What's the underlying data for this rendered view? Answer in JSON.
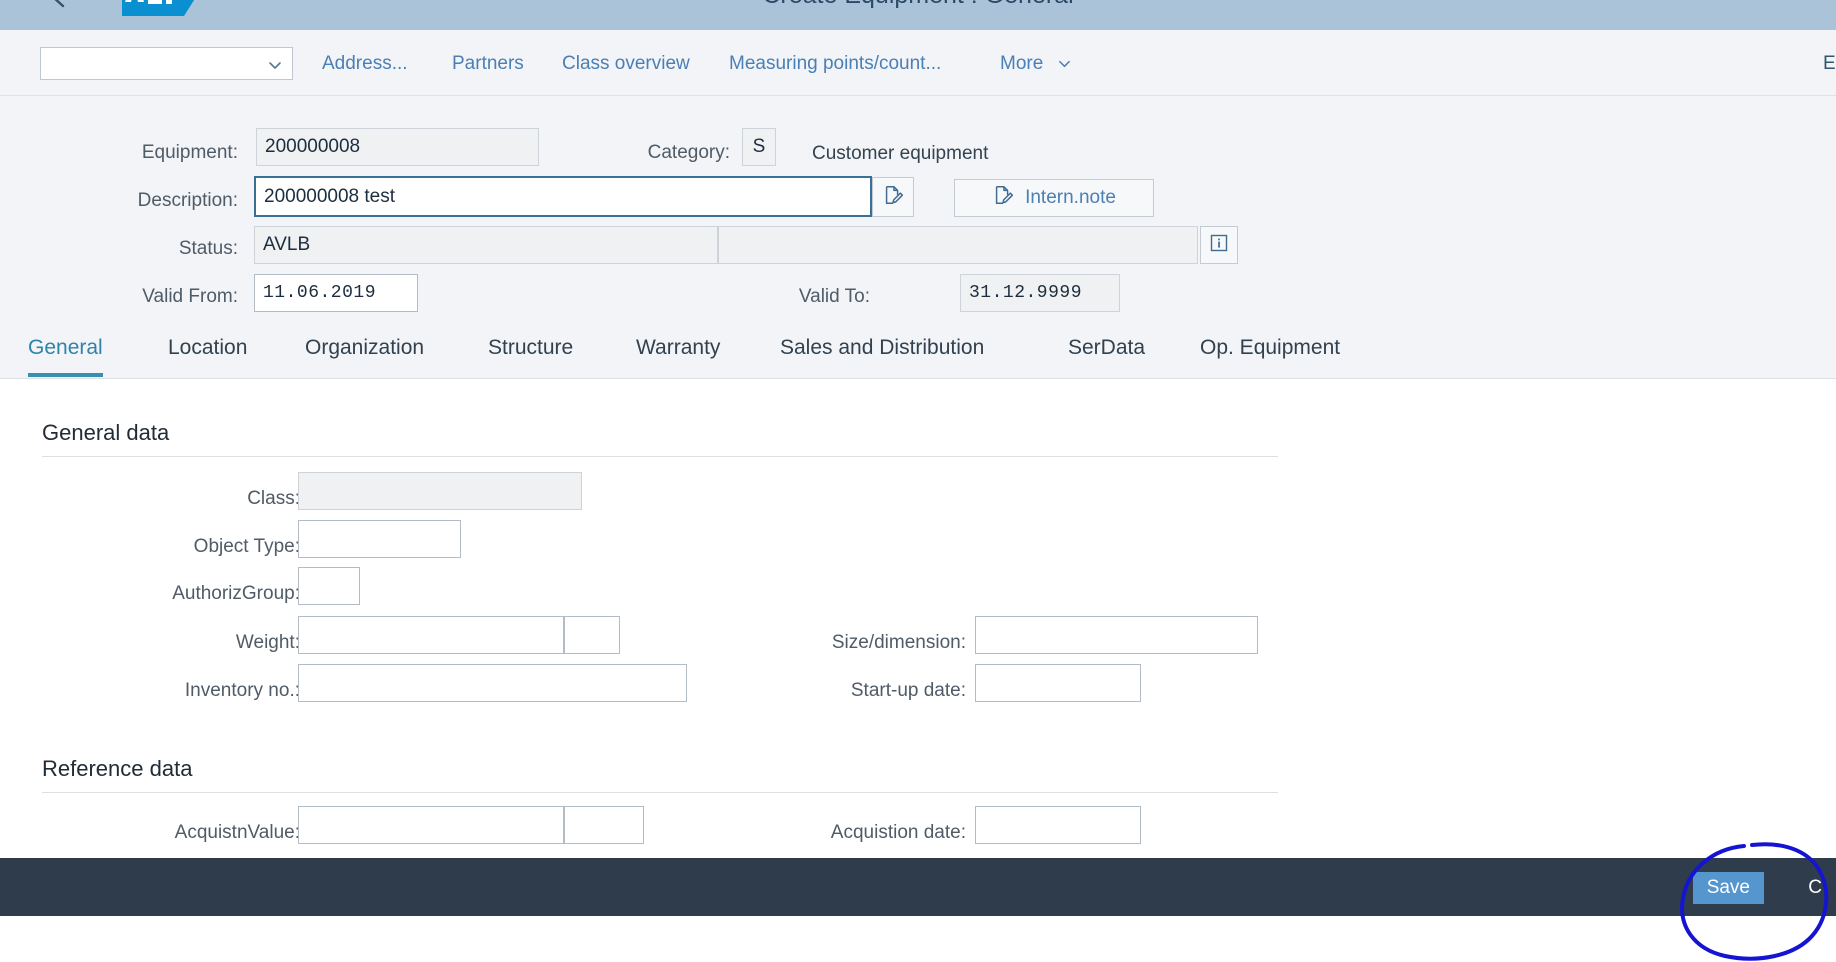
{
  "shell": {
    "title": "Create Equipment : General",
    "back_icon": "back-chevron-icon",
    "logo_text": "SAP"
  },
  "toolbar": {
    "select_value": "",
    "select_icon": "chevron-down-icon",
    "actions": [
      {
        "label": "Address..."
      },
      {
        "label": "Partners"
      },
      {
        "label": "Class overview"
      },
      {
        "label": "Measuring points/count..."
      }
    ],
    "more_label": "More",
    "more_icon": "chevron-down-icon",
    "right_label": "E"
  },
  "object_header": {
    "equipment_label": "Equipment:",
    "equipment_value": "200000008",
    "category_label": "Category:",
    "category_value": "S",
    "category_text": "Customer equipment",
    "description_label": "Description:",
    "description_value": "200000008 test",
    "description_placeholder": "",
    "description_edit_icon": "edit-note-icon",
    "intern_note_label": "Intern.note",
    "intern_note_icon": "edit-note-icon",
    "status_label": "Status:",
    "status_value": "AVLB",
    "status_secondary": "",
    "status_info_icon": "information-icon",
    "valid_from_label": "Valid From:",
    "valid_from_value": "11.06.2019",
    "valid_to_label": "Valid To:",
    "valid_to_value": "31.12.9999"
  },
  "tabs": [
    {
      "label": "General",
      "selected": true
    },
    {
      "label": "Location",
      "selected": false
    },
    {
      "label": "Organization",
      "selected": false
    },
    {
      "label": "Structure",
      "selected": false
    },
    {
      "label": "Warranty",
      "selected": false
    },
    {
      "label": "Sales and Distribution",
      "selected": false
    },
    {
      "label": "SerData",
      "selected": false
    },
    {
      "label": "Op. Equipment",
      "selected": false
    }
  ],
  "general_data": {
    "section_title": "General data",
    "class_label": "Class:",
    "class_value": "",
    "object_type_label": "Object Type:",
    "object_type_value": "",
    "authoriz_group_label": "AuthorizGroup:",
    "authoriz_group_value": "",
    "weight_label": "Weight:",
    "weight_value": "",
    "weight_unit_value": "",
    "size_dimension_label": "Size/dimension:",
    "size_dimension_value": "",
    "inventory_no_label": "Inventory no.:",
    "inventory_no_value": "",
    "start_up_date_label": "Start-up date:",
    "start_up_date_value": ""
  },
  "reference_data": {
    "section_title": "Reference data",
    "acquistn_value_label": "AcquistnValue:",
    "acquistn_value_value": "",
    "acquistn_currency_value": "",
    "acquistion_date_label": "Acquistion date:",
    "acquistion_date_value": ""
  },
  "footer": {
    "save_label": "Save",
    "cancel_label": "C"
  },
  "annotation": {
    "shape": "hand-drawn-ellipse",
    "color": "#1414d2",
    "target": "save-button"
  },
  "colors": {
    "shell_header": "#abc3d8",
    "toolbar_bg": "#f2f4f7",
    "link": "#4a7fb5",
    "tab_selected": "#2e84a8",
    "footer_bg": "#2f3c4c",
    "save_button": "#5596cf",
    "annotation": "#1414d2"
  }
}
